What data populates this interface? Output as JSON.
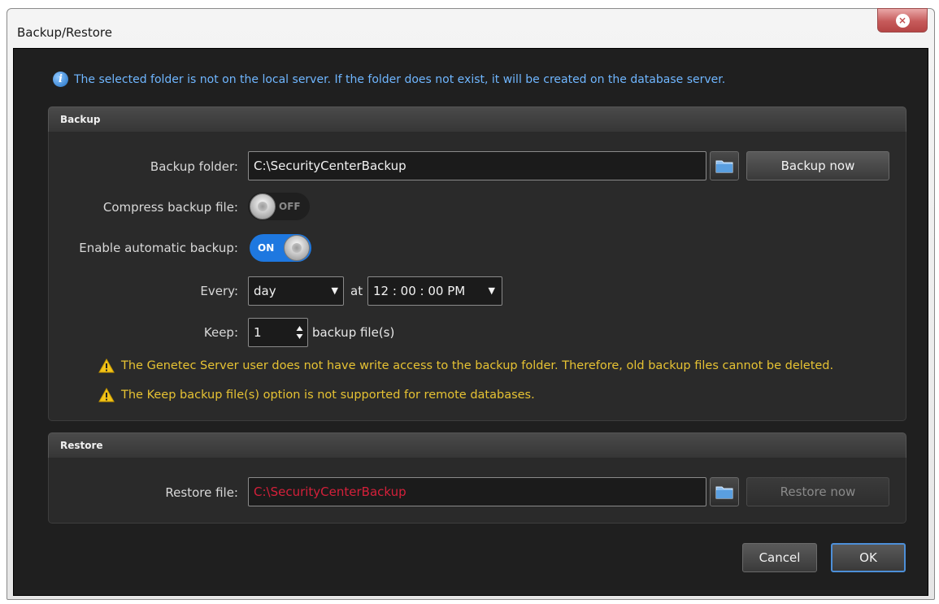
{
  "window": {
    "title": "Backup/Restore",
    "close_symbol": "⨯"
  },
  "info": {
    "icon": "info-icon",
    "text": "The selected folder is not on the local server. If the folder does not exist, it will be created on the database server."
  },
  "backup": {
    "header": "Backup",
    "folder_label": "Backup folder:",
    "folder_value": "C:\\SecurityCenterBackup",
    "backup_now_label": "Backup now",
    "compress_label": "Compress backup file:",
    "compress_state": "OFF",
    "auto_label": "Enable automatic backup:",
    "auto_state": "ON",
    "every_label": "Every:",
    "every_value": "day",
    "at_label": "at",
    "time_value": "12 : 00 : 00 PM",
    "keep_label": "Keep:",
    "keep_value": "1",
    "keep_suffix": "backup file(s)",
    "warnings": [
      "The Genetec Server user does not have write access to the backup folder. Therefore, old backup files cannot be deleted.",
      "The Keep backup file(s) option is not supported for remote databases."
    ]
  },
  "restore": {
    "header": "Restore",
    "file_label": "Restore file:",
    "file_value": "C:\\SecurityCenterBackup",
    "restore_now_label": "Restore now"
  },
  "footer": {
    "cancel_label": "Cancel",
    "ok_label": "OK"
  },
  "colors": {
    "info_text": "#6fb6ff",
    "warning_text": "#e6c233",
    "toggle_on": "#1e78e0",
    "invalid_path": "#d4203a"
  }
}
